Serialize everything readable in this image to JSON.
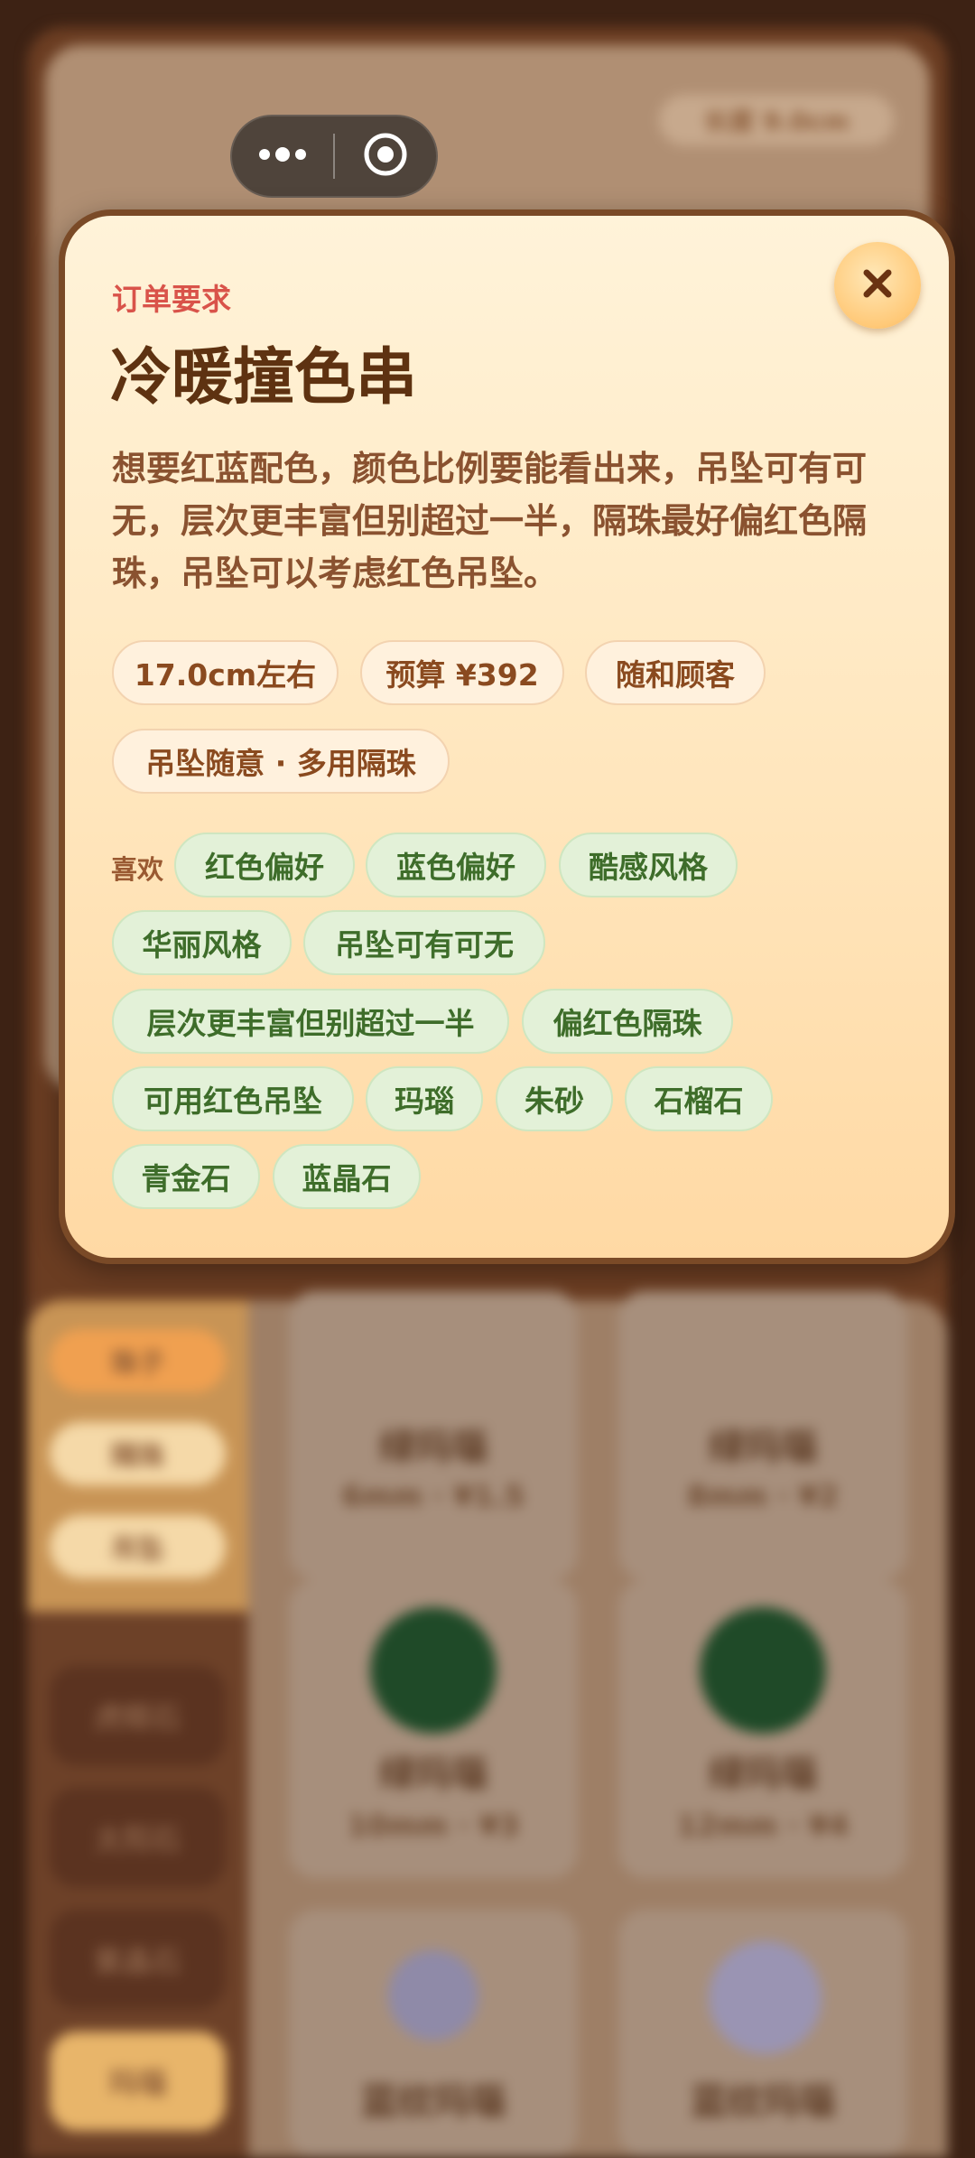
{
  "background": {
    "length_pill": "长度 9.0cm",
    "tabs": [
      "珠子",
      "隔珠",
      "吊坠"
    ],
    "side_items": [
      "虎眼石",
      "太阳石",
      "紫晶石",
      "玛瑙"
    ],
    "cards": [
      {
        "name": "绿玛瑙",
        "spec": "6mm · ¥1.5"
      },
      {
        "name": "绿玛瑙",
        "spec": "8mm · ¥2"
      },
      {
        "name": "绿玛瑙",
        "spec": "10mm · ¥3"
      },
      {
        "name": "绿玛瑙",
        "spec": "12mm · ¥4"
      },
      {
        "name": "蓝纹玛瑙",
        "spec": ""
      },
      {
        "name": "蓝纹玛瑙",
        "spec": ""
      }
    ]
  },
  "modal": {
    "label": "订单要求",
    "title": "冷暖撞色串",
    "description": "想要红蓝配色，颜色比例要能看出来，吊坠可有可无，层次更丰富但别超过一半，隔珠最好偏红色隔珠，吊坠可以考虑红色吊坠。",
    "tags": [
      "17.0cm左右",
      "预算 ¥392",
      "随和顾客",
      "吊坠随意 · 多用隔珠"
    ],
    "likes_label": "喜欢",
    "likes": [
      "红色偏好",
      "蓝色偏好",
      "酷感风格",
      "华丽风格",
      "吊坠可有可无",
      "层次更丰富但别超过一半",
      "偏红色隔珠",
      "可用红色吊坠",
      "玛瑙",
      "朱砂",
      "石榴石",
      "青金石",
      "蓝晶石"
    ]
  },
  "colors": {
    "accent_label": "#d9534a",
    "title": "#5e3211",
    "like_text": "#3e6d2a",
    "like_bg": "#e3f1d8"
  },
  "icons": {
    "close": "close-icon",
    "menu": "more-dots-icon",
    "exit": "target-icon"
  }
}
